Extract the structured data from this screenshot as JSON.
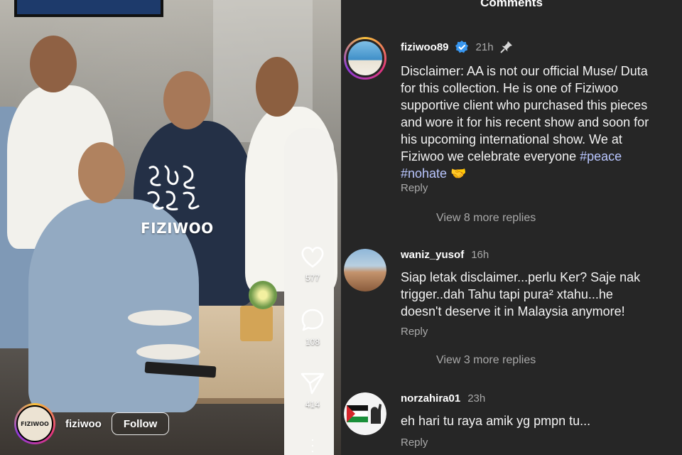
{
  "video": {
    "watermark": "FIZIWOO",
    "actions": {
      "likes": "577",
      "comments": "108",
      "shares": "414"
    },
    "author": {
      "username": "fiziwoo",
      "avatar_text": "FIZIWOO",
      "follow_label": "Follow"
    },
    "icons": [
      "heart-icon",
      "comment-bubble-icon",
      "paper-plane-icon",
      "more-dots-icon"
    ]
  },
  "comments_panel": {
    "title": "Comments",
    "comments": [
      {
        "username": "fiziwoo89",
        "verified": true,
        "time": "21h",
        "pinned": true,
        "text_lines": [
          "Disclaimer: AA is not our official Muse/ Duta",
          "for this collection. He is one of Fiziwoo",
          "supportive client who purchased this pieces",
          "and wore it for his recent show and soon for",
          "his upcoming international show. We at",
          "Fiziwoo we celebrate everyone"
        ],
        "hashtags": [
          "#peace",
          "#nohate"
        ],
        "emoji": "🤝",
        "reply_label": "Reply",
        "more_replies": "View 8 more replies"
      },
      {
        "username": "waniz_yusof",
        "time": "16h",
        "text_lines": [
          "Siap letak disclaimer...perlu Ker? Saje nak",
          "trigger..dah Tahu tapi pura² xtahu...he",
          "doesn't deserve it in Malaysia anymore!"
        ],
        "reply_label": "Reply",
        "more_replies": "View 3 more replies"
      },
      {
        "username": "norzahira01",
        "time": "23h",
        "text_lines": [
          "eh hari tu raya amik yg pmpn tu..."
        ],
        "reply_label": "Reply"
      }
    ]
  },
  "colors": {
    "panel_bg": "#262626",
    "hashtag": "#b9c6ff",
    "muted": "#a9a9a9",
    "verified": "#3897f0"
  }
}
